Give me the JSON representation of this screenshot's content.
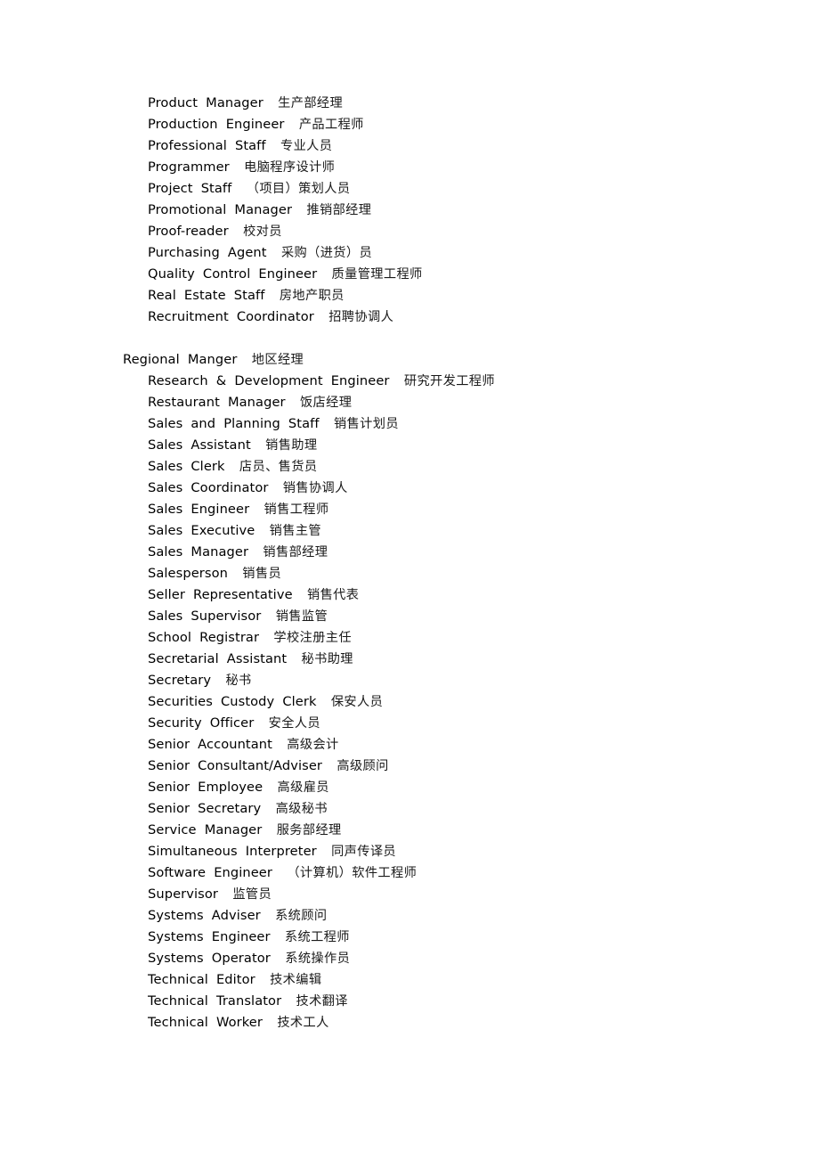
{
  "document": {
    "type": "glossary",
    "subject": "English-Chinese job title glossary",
    "background_color": "#ffffff",
    "text_color": "#000000"
  },
  "entries": [
    {
      "indent": 1,
      "term": [
        "Product",
        "Manager"
      ],
      "cn": "生产部经理"
    },
    {
      "indent": 1,
      "term": [
        "Production",
        "Engineer"
      ],
      "cn": "产品工程师"
    },
    {
      "indent": 1,
      "term": [
        "Professional",
        "Staff"
      ],
      "cn": "专业人员"
    },
    {
      "indent": 1,
      "term": [
        "Programmer"
      ],
      "cn": "电脑程序设计师"
    },
    {
      "indent": 1,
      "term": [
        "Project",
        "Staff"
      ],
      "cn": "（项目）策划人员"
    },
    {
      "indent": 1,
      "term": [
        "Promotional",
        "Manager"
      ],
      "cn": "推销部经理"
    },
    {
      "indent": 1,
      "term": [
        "Proof-reader"
      ],
      "cn": "校对员"
    },
    {
      "indent": 1,
      "term": [
        "Purchasing",
        "Agent"
      ],
      "cn": "采购（进货）员"
    },
    {
      "indent": 1,
      "term": [
        "Quality",
        "Control",
        "Engineer"
      ],
      "cn": "质量管理工程师"
    },
    {
      "indent": 1,
      "term": [
        "Real",
        "Estate",
        "Staff"
      ],
      "cn": "房地产职员"
    },
    {
      "indent": 1,
      "term": [
        "Recruitment",
        "Coordinator"
      ],
      "cn": "招聘协调人"
    },
    {
      "indent": 1,
      "term": [],
      "cn": "",
      "blank": true
    },
    {
      "indent": 0,
      "term": [
        "Regional",
        "Manger"
      ],
      "cn": "地区经理"
    },
    {
      "indent": 1,
      "term": [
        "Research",
        "&",
        "Development",
        "Engineer"
      ],
      "cn": "研究开发工程师"
    },
    {
      "indent": 1,
      "term": [
        "Restaurant",
        "Manager"
      ],
      "cn": "饭店经理"
    },
    {
      "indent": 1,
      "term": [
        "Sales",
        "and",
        "Planning",
        "Staff"
      ],
      "cn": "销售计划员"
    },
    {
      "indent": 1,
      "term": [
        "Sales",
        "Assistant"
      ],
      "cn": "销售助理"
    },
    {
      "indent": 1,
      "term": [
        "Sales",
        "Clerk"
      ],
      "cn": "店员、售货员"
    },
    {
      "indent": 1,
      "term": [
        "Sales",
        "Coordinator"
      ],
      "cn": "销售协调人"
    },
    {
      "indent": 1,
      "term": [
        "Sales",
        "Engineer"
      ],
      "cn": "销售工程师"
    },
    {
      "indent": 1,
      "term": [
        "Sales",
        "Executive"
      ],
      "cn": "销售主管"
    },
    {
      "indent": 1,
      "term": [
        "Sales",
        "Manager"
      ],
      "cn": "销售部经理"
    },
    {
      "indent": 1,
      "term": [
        "Salesperson"
      ],
      "cn": "销售员"
    },
    {
      "indent": 1,
      "term": [
        "Seller",
        "Representative"
      ],
      "cn": "销售代表"
    },
    {
      "indent": 1,
      "term": [
        "Sales",
        "Supervisor"
      ],
      "cn": "销售监管"
    },
    {
      "indent": 1,
      "term": [
        "School",
        "Registrar"
      ],
      "cn": "学校注册主任"
    },
    {
      "indent": 1,
      "term": [
        "Secretarial",
        "Assistant"
      ],
      "cn": "秘书助理"
    },
    {
      "indent": 1,
      "term": [
        "Secretary"
      ],
      "cn": "秘书"
    },
    {
      "indent": 1,
      "term": [
        "Securities",
        "Custody",
        "Clerk"
      ],
      "cn": "保安人员"
    },
    {
      "indent": 1,
      "term": [
        "Security",
        "Officer"
      ],
      "cn": "安全人员"
    },
    {
      "indent": 1,
      "term": [
        "Senior",
        "Accountant"
      ],
      "cn": "高级会计"
    },
    {
      "indent": 1,
      "term": [
        "Senior",
        "Consultant/Adviser"
      ],
      "cn": "高级顾问"
    },
    {
      "indent": 1,
      "term": [
        "Senior",
        "Employee"
      ],
      "cn": "高级雇员"
    },
    {
      "indent": 1,
      "term": [
        "Senior",
        "Secretary"
      ],
      "cn": "高级秘书"
    },
    {
      "indent": 1,
      "term": [
        "Service",
        "Manager"
      ],
      "cn": "服务部经理"
    },
    {
      "indent": 1,
      "term": [
        "Simultaneous",
        "Interpreter"
      ],
      "cn": "同声传译员"
    },
    {
      "indent": 1,
      "term": [
        "Software",
        "Engineer"
      ],
      "cn": "（计算机）软件工程师"
    },
    {
      "indent": 1,
      "term": [
        "Supervisor"
      ],
      "cn": "监管员"
    },
    {
      "indent": 1,
      "term": [
        "Systems",
        "Adviser"
      ],
      "cn": "系统顾问"
    },
    {
      "indent": 1,
      "term": [
        "Systems",
        "Engineer"
      ],
      "cn": "系统工程师"
    },
    {
      "indent": 1,
      "term": [
        "Systems",
        "Operator"
      ],
      "cn": "系统操作员"
    },
    {
      "indent": 1,
      "term": [
        "Technical",
        "Editor"
      ],
      "cn": "技术编辑"
    },
    {
      "indent": 1,
      "term": [
        "Technical",
        "Translator"
      ],
      "cn": "技术翻译"
    },
    {
      "indent": 1,
      "term": [
        "Technical",
        "Worker"
      ],
      "cn": "技术工人"
    }
  ]
}
